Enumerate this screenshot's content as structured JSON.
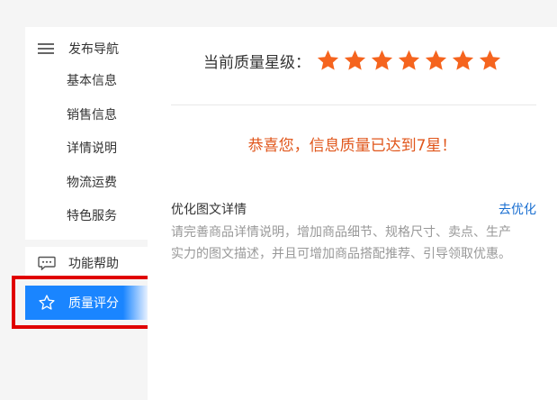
{
  "sidebar": {
    "header": {
      "title": "发布导航",
      "icon": "menu-icon"
    },
    "items": [
      {
        "label": "基本信息"
      },
      {
        "label": "销售信息"
      },
      {
        "label": "详情说明"
      },
      {
        "label": "物流运费"
      },
      {
        "label": "特色服务"
      }
    ],
    "help": {
      "label": "功能帮助",
      "icon": "chat-bubble-icon"
    },
    "quality": {
      "label": "质量评分",
      "icon": "star-outline-icon",
      "bg_color": "#1a85ff"
    }
  },
  "main": {
    "rating_label": "当前质量星级：",
    "stars": {
      "count": 7,
      "max": 7,
      "color": "#f5641e"
    },
    "congrats": "恭喜您，信息质量已达到7星！",
    "optimize": {
      "title": "优化图文详情",
      "link": "去优化",
      "desc_line1": "请完善商品详情说明，增加商品细节、规格尺寸、卖点、生产",
      "desc_line2": "实力的图文描述，并且可增加商品搭配推荐、引导领取优惠。"
    }
  },
  "colors": {
    "accent": "#1a85ff",
    "highlight": "#e00000",
    "congrats": "#e0561b",
    "link": "#1a6fd1"
  }
}
